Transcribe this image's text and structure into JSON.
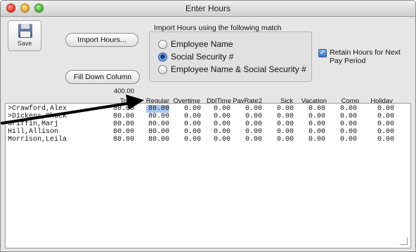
{
  "window": {
    "title": "Enter Hours"
  },
  "toolbar": {
    "save_label": "Save"
  },
  "buttons": {
    "import_hours": "Import Hours...",
    "fill_down": "Fill Down Column"
  },
  "match": {
    "title": "Import Hours using the following match",
    "options": [
      {
        "label": "Employee Name",
        "selected": false
      },
      {
        "label": "Social Security #",
        "selected": true
      },
      {
        "label": "Employee Name & Social Security #",
        "selected": false
      }
    ]
  },
  "retain": {
    "label": "Retain Hours for Next Pay Period",
    "checked": true
  },
  "totals": {
    "total_hours": "400.00"
  },
  "columns": [
    "Total",
    "Regular",
    "Overtime",
    "DblTime",
    "PayRate2",
    "Sick",
    "Vacation",
    "Comp",
    "Holiday"
  ],
  "rows": [
    {
      "name": ">Crawford,Alex",
      "values": [
        "80.00",
        "80.00",
        "0.00",
        "0.00",
        "0.00",
        "0.00",
        "0.00",
        "0.00",
        "0.00"
      ]
    },
    {
      "name": ">Dickens,Chuck",
      "values": [
        "80.00",
        "80.00",
        "0.00",
        "0.00",
        "0.00",
        "0.00",
        "0.00",
        "0.00",
        "0.00"
      ]
    },
    {
      "name": " Griffin,Marj",
      "values": [
        "80.00",
        "80.00",
        "0.00",
        "0.00",
        "0.00",
        "0.00",
        "0.00",
        "0.00",
        "0.00"
      ]
    },
    {
      "name": " Hill,Allison",
      "values": [
        "80.00",
        "80.00",
        "0.00",
        "0.00",
        "0.00",
        "0.00",
        "0.00",
        "0.00",
        "0.00"
      ]
    },
    {
      "name": " Morrison,Leila",
      "values": [
        "80.00",
        "80.00",
        "0.00",
        "0.00",
        "0.00",
        "0.00",
        "0.00",
        "0.00",
        "0.00"
      ]
    }
  ]
}
